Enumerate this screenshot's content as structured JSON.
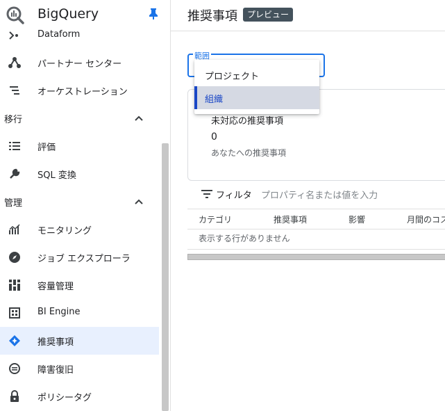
{
  "brand": {
    "name": "BigQuery",
    "logo_icon": "bigquery-logo",
    "pin_icon": "pin-icon"
  },
  "sidebar": {
    "items_top": [
      {
        "label": "Dataform",
        "icon": "dataform-icon"
      },
      {
        "label": "パートナー センター",
        "icon": "partner-center-icon"
      },
      {
        "label": "オーケストレーション",
        "icon": "orchestration-icon"
      }
    ],
    "sections": [
      {
        "label": "移行",
        "items": [
          {
            "label": "評価",
            "icon": "assessment-icon"
          },
          {
            "label": "SQL 変換",
            "icon": "wrench-icon"
          }
        ]
      },
      {
        "label": "管理",
        "items": [
          {
            "label": "モニタリング",
            "icon": "monitoring-icon"
          },
          {
            "label": "ジョブ エクスプローラ",
            "icon": "compass-icon"
          },
          {
            "label": "容量管理",
            "icon": "capacity-icon"
          },
          {
            "label": "BI Engine",
            "icon": "bi-engine-icon"
          },
          {
            "label": "推奨事項",
            "icon": "recommendations-icon",
            "active": true
          },
          {
            "label": "障害復旧",
            "icon": "disaster-recovery-icon"
          },
          {
            "label": "ポリシータグ",
            "icon": "lock-icon"
          }
        ]
      }
    ]
  },
  "header": {
    "title": "推奨事項",
    "badge": "プレビュー"
  },
  "scope": {
    "label": "範囲",
    "options": [
      "プロジェクト",
      "組織"
    ],
    "selected": "組織"
  },
  "card": {
    "title": "未対応の推奨事項",
    "count": "0",
    "subtitle": "あなたへの推奨事項"
  },
  "filter": {
    "label": "フィルタ",
    "placeholder": "プロパティ名または値を入力"
  },
  "table": {
    "columns": [
      "カテゴリ",
      "推奨事項",
      "影響",
      "月間のコス"
    ],
    "empty_text": "表示する行がありません"
  },
  "colors": {
    "accent": "#1a73e8",
    "active_bg": "#e8f0fe",
    "selected_option_bg": "#d5d9e3",
    "badge_bg": "#44525c"
  }
}
